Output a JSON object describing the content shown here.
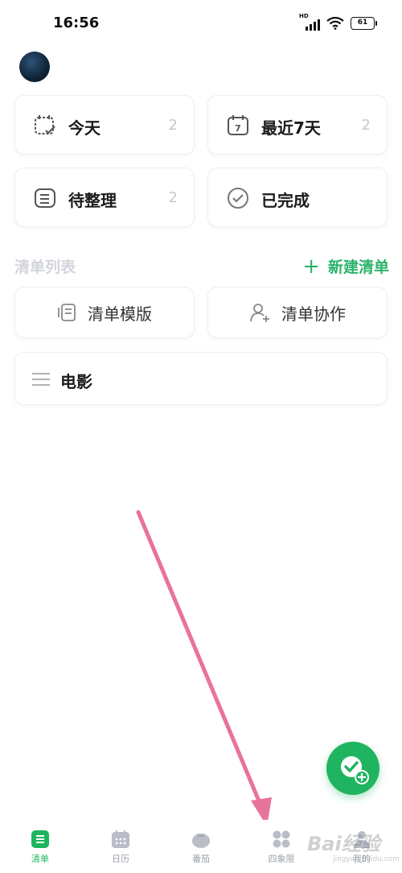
{
  "status_bar": {
    "time": "16:56",
    "network": "HD",
    "battery": "61"
  },
  "smart_lists": [
    {
      "label": "今天",
      "count": "2",
      "icon": "calendar-check-icon"
    },
    {
      "label": "最近7天",
      "count": "2",
      "icon": "calendar-7-icon"
    },
    {
      "label": "待整理",
      "count": "2",
      "icon": "inbox-icon"
    },
    {
      "label": "已完成",
      "icon": "check-circle-icon"
    }
  ],
  "section": {
    "title": "清单列表",
    "new_list": "新建清单"
  },
  "tools": [
    {
      "label": "清单模版",
      "icon": "template-icon"
    },
    {
      "label": "清单协作",
      "icon": "add-person-icon"
    }
  ],
  "lists": [
    {
      "label": "电影",
      "icon": "list-lines-icon"
    }
  ],
  "fab": {
    "icon": "check-add-icon"
  },
  "tabs": [
    {
      "label": "清单",
      "icon": "list-icon",
      "active": true
    },
    {
      "label": "日历",
      "icon": "calendar-icon"
    },
    {
      "label": "番茄",
      "icon": "tomato-icon"
    },
    {
      "label": "四象限",
      "icon": "quadrant-icon"
    },
    {
      "label": "我的",
      "icon": "profile-icon"
    }
  ],
  "watermark": {
    "text": "Bai经验",
    "url": "jingyan.baidu.com"
  },
  "colors": {
    "accent": "#1fb45f",
    "annotation_arrow": "#e8739a",
    "muted": "#c4c7cf"
  }
}
